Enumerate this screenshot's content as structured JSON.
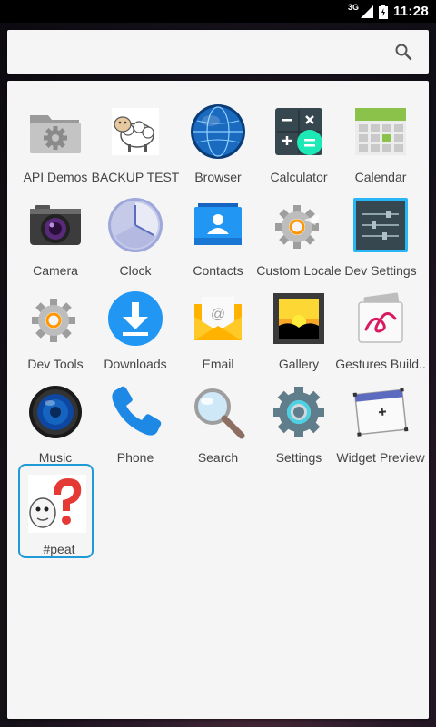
{
  "status_bar": {
    "network": "3G",
    "time": "11:28"
  },
  "search": {
    "icon": "search-icon"
  },
  "apps": [
    {
      "label": "API Demos",
      "icon": "folder-gear-icon"
    },
    {
      "label": "BACKUP TEST",
      "icon": "sheep-icon"
    },
    {
      "label": "Browser",
      "icon": "globe-icon"
    },
    {
      "label": "Calculator",
      "icon": "calculator-icon"
    },
    {
      "label": "Calendar",
      "icon": "calendar-icon"
    },
    {
      "label": "Camera",
      "icon": "camera-icon"
    },
    {
      "label": "Clock",
      "icon": "clock-icon"
    },
    {
      "label": "Contacts",
      "icon": "contacts-icon"
    },
    {
      "label": "Custom Locale",
      "icon": "gear-icon"
    },
    {
      "label": "Dev Settings",
      "icon": "sliders-icon"
    },
    {
      "label": "Dev Tools",
      "icon": "gear-icon"
    },
    {
      "label": "Downloads",
      "icon": "download-icon"
    },
    {
      "label": "Email",
      "icon": "envelope-icon"
    },
    {
      "label": "Gallery",
      "icon": "picture-icon"
    },
    {
      "label": "Gestures Build..",
      "icon": "gesture-icon"
    },
    {
      "label": "Music",
      "icon": "speaker-icon"
    },
    {
      "label": "Phone",
      "icon": "phone-icon"
    },
    {
      "label": "Search",
      "icon": "magnifier-icon"
    },
    {
      "label": "Settings",
      "icon": "settings-gear-icon"
    },
    {
      "label": "Widget Preview",
      "icon": "widget-icon"
    },
    {
      "label": "#peat",
      "icon": "question-mascot-icon"
    }
  ],
  "colors": {
    "focus_border": "#1e9bd7",
    "panel_bg": "#f5f5f5",
    "label_text": "#444444"
  }
}
